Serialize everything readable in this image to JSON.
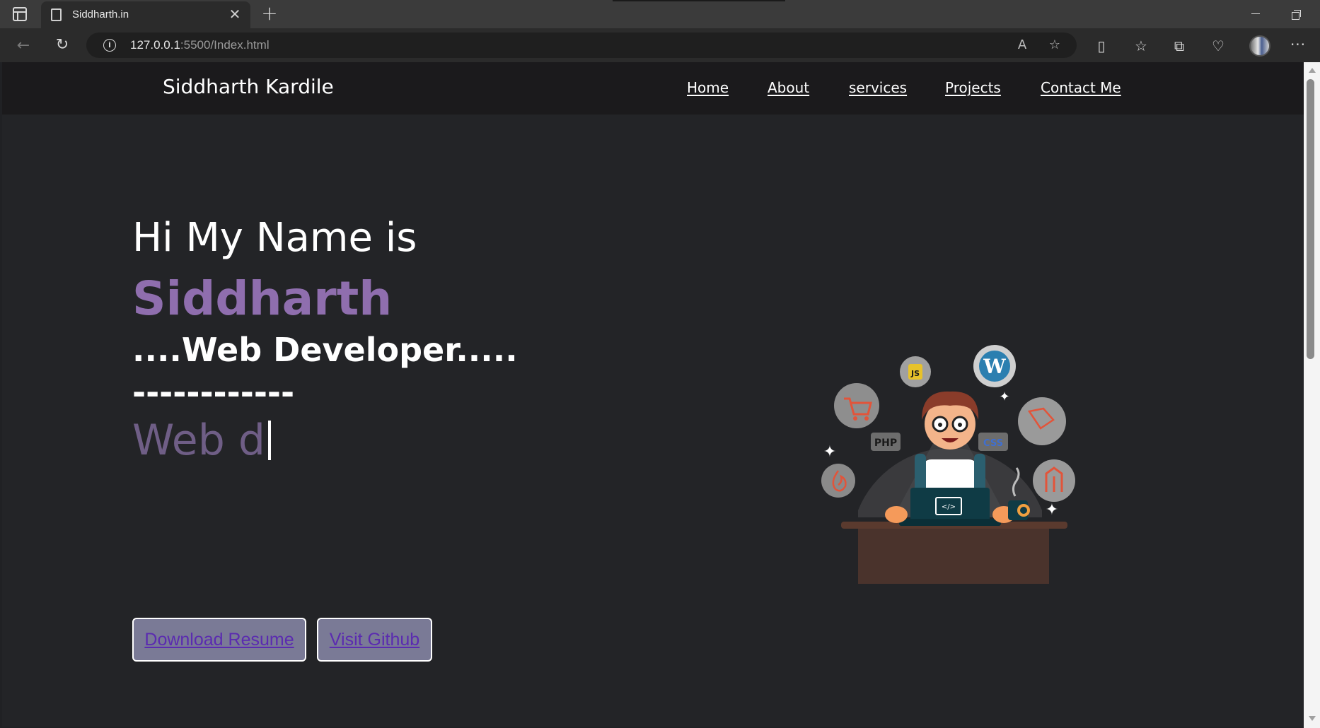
{
  "browser": {
    "tab_title": "Siddharth.in",
    "url_host": "127.0.0.1",
    "url_rest": ":5500/Index.html"
  },
  "site": {
    "brand": "Siddharth Kardile",
    "nav": [
      "Home",
      "About",
      "services",
      "Projects",
      "Contact Me"
    ],
    "hero": {
      "greeting": "Hi My Name is",
      "name": "Siddharth",
      "role": "....Web Developer.....",
      "dashes": "------------",
      "typing_text": "Web d"
    },
    "buttons": {
      "resume": "Download Resume",
      "github": "Visit Github"
    },
    "illustration": {
      "badge_php": "PHP",
      "badge_css": "CSS"
    }
  },
  "colors": {
    "accent_purple": "#8f6eae",
    "typing_purple": "#6f5e86",
    "button_bg": "#7a7a96",
    "button_text": "#5b2bb0",
    "page_bg": "#232427",
    "nav_bg": "#1b1a1c"
  },
  "icons": {
    "back": "arrow-left",
    "reload": "refresh",
    "info": "info",
    "read_aloud": "read-aloud",
    "favorite": "star",
    "split_screen": "split-screen",
    "favorites": "favorites-list",
    "collections": "collections",
    "performance": "heart-pulse",
    "more": "ellipsis"
  }
}
